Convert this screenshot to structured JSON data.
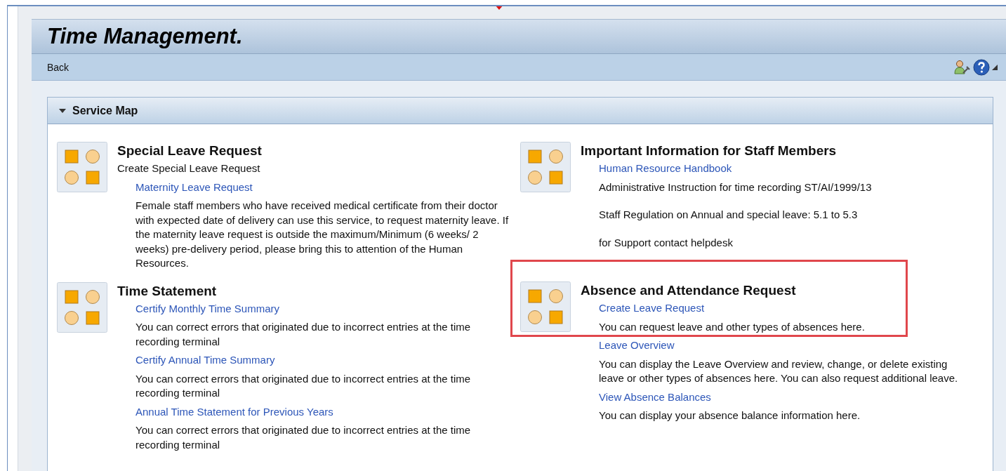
{
  "page": {
    "title": "Time Management.",
    "back": "Back"
  },
  "service_map": {
    "title": "Service Map",
    "expanded": true,
    "columns": [
      [
        {
          "title": "Special Leave Request",
          "highlighted": false,
          "items": [
            {
              "kind": "caption",
              "text": "Create Special Leave Request"
            },
            {
              "kind": "link",
              "text": "Maternity Leave Request"
            },
            {
              "kind": "text",
              "text": "Female staff members who have received medical certificate from their doctor with expected date of delivery can use this service, to request maternity leave. If the maternity leave request is outside the maximum/Minimum (6 weeks/ 2 weeks) pre-delivery period, please bring this to attention of the Human Resources."
            }
          ]
        },
        {
          "title": "Time Statement",
          "highlighted": false,
          "items": [
            {
              "kind": "link",
              "text": "Certify Monthly Time Summary"
            },
            {
              "kind": "text",
              "text": "You can correct errors that originated due to incorrect entries at the time recording terminal"
            },
            {
              "kind": "link",
              "text": "Certify Annual Time Summary"
            },
            {
              "kind": "text",
              "text": "You can correct errors that originated due to incorrect entries at the time recording terminal"
            },
            {
              "kind": "link",
              "text": "Annual Time Statement for Previous Years"
            },
            {
              "kind": "text",
              "text": "You can correct errors that originated due to incorrect entries at the time recording terminal"
            }
          ]
        }
      ],
      [
        {
          "title": "Important Information for Staff Members",
          "highlighted": false,
          "items": [
            {
              "kind": "link",
              "text": "Human Resource Handbook"
            },
            {
              "kind": "note",
              "text": "Administrative Instruction for time recording ST/AI/1999/13"
            },
            {
              "kind": "note",
              "text": "Staff Regulation on Annual and special leave: 5.1 to 5.3"
            },
            {
              "kind": "note",
              "text": "for Support contact helpdesk"
            }
          ]
        },
        {
          "title": "Absence and Attendance Request",
          "highlighted": true,
          "items": [
            {
              "kind": "link",
              "text": "Create Leave Request"
            },
            {
              "kind": "text",
              "text": "You can request leave and other types of absences here."
            },
            {
              "kind": "link",
              "text": "Leave Overview"
            },
            {
              "kind": "text",
              "text": "You can display the Leave Overview and review, change, or delete existing leave or other types of absences here. You can also request additional leave."
            },
            {
              "kind": "link",
              "text": "View Absence Balances"
            },
            {
              "kind": "text",
              "text": "You can display your absence balance information here."
            }
          ]
        }
      ]
    ]
  }
}
